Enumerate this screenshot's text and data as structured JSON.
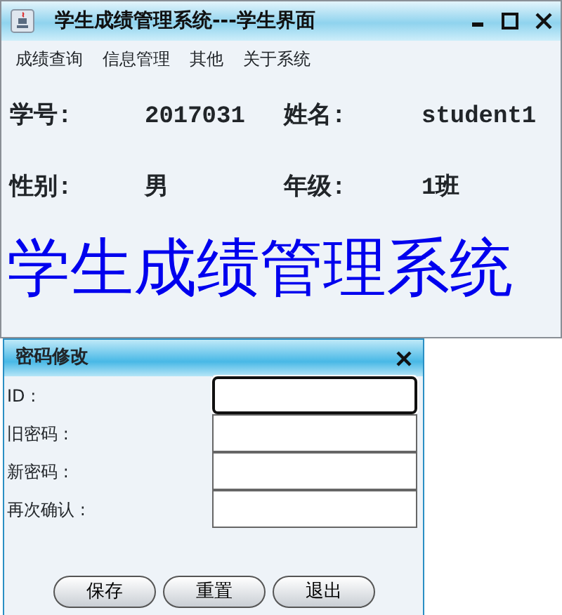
{
  "main_window": {
    "title": "学生成绩管理系统---学生界面"
  },
  "menu": [
    "成绩查询",
    "信息管理",
    "其他",
    "关于系统"
  ],
  "info_rows": [
    {
      "label_1": "学号:",
      "value_1": "2017031",
      "label_2": "姓名:",
      "value_2": "student1"
    },
    {
      "label_1": "性别:",
      "value_1": "男",
      "label_2": "年级:",
      "value_2": "1班"
    }
  ],
  "banner": "学生成绩管理系统",
  "dialog": {
    "title": "密码修改",
    "fields": [
      {
        "label": "ID :",
        "focused": true
      },
      {
        "label": "旧密码 :",
        "focused": false
      },
      {
        "label": "新密码 :",
        "focused": false
      },
      {
        "label": "再次确认 :",
        "focused": false
      }
    ],
    "buttons": [
      "保存",
      "重置",
      "退出"
    ]
  }
}
